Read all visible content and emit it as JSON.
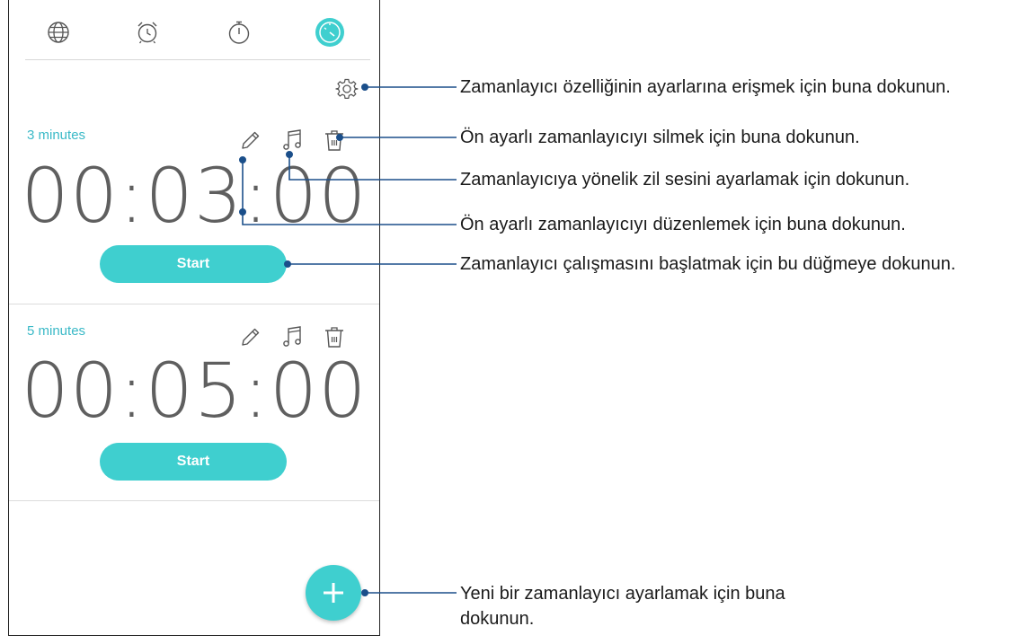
{
  "tabs": [
    {
      "name": "world-clock",
      "icon": "globe-icon"
    },
    {
      "name": "alarm",
      "icon": "alarm-clock-icon"
    },
    {
      "name": "stopwatch",
      "icon": "stopwatch-icon"
    },
    {
      "name": "timer",
      "icon": "timer-icon",
      "active": true
    }
  ],
  "settings_icon": "gear-icon",
  "presets": [
    {
      "label": "3 minutes",
      "time": "00:03:00",
      "start_label": "Start"
    },
    {
      "label": "5 minutes",
      "time": "00:05:00",
      "start_label": "Start"
    }
  ],
  "card_icons": [
    "pencil-icon",
    "music-note-icon",
    "trash-icon"
  ],
  "fab_icon": "plus-icon",
  "callouts": {
    "settings": "Zamanlayıcı özelliğinin ayarlarına erişmek için buna dokunun.",
    "delete": "Ön ayarlı zamanlayıcıyı silmek için buna dokunun.",
    "ringtone": "Zamanlayıcıya yönelik zil sesini ayarlamak için dokunun.",
    "edit": "Ön ayarlı zamanlayıcıyı düzenlemek için buna dokunun.",
    "start": "Zamanlayıcı çalışmasını başlatmak için bu düğmeye dokunun.",
    "add_line1": "Yeni bir zamanlayıcı ayarlamak için buna",
    "add_line2": "dokunun."
  },
  "colors": {
    "accent": "#3fcfcf",
    "label": "#3ab9c7",
    "callout_line": "#1b4f8a",
    "icon": "#555555"
  }
}
